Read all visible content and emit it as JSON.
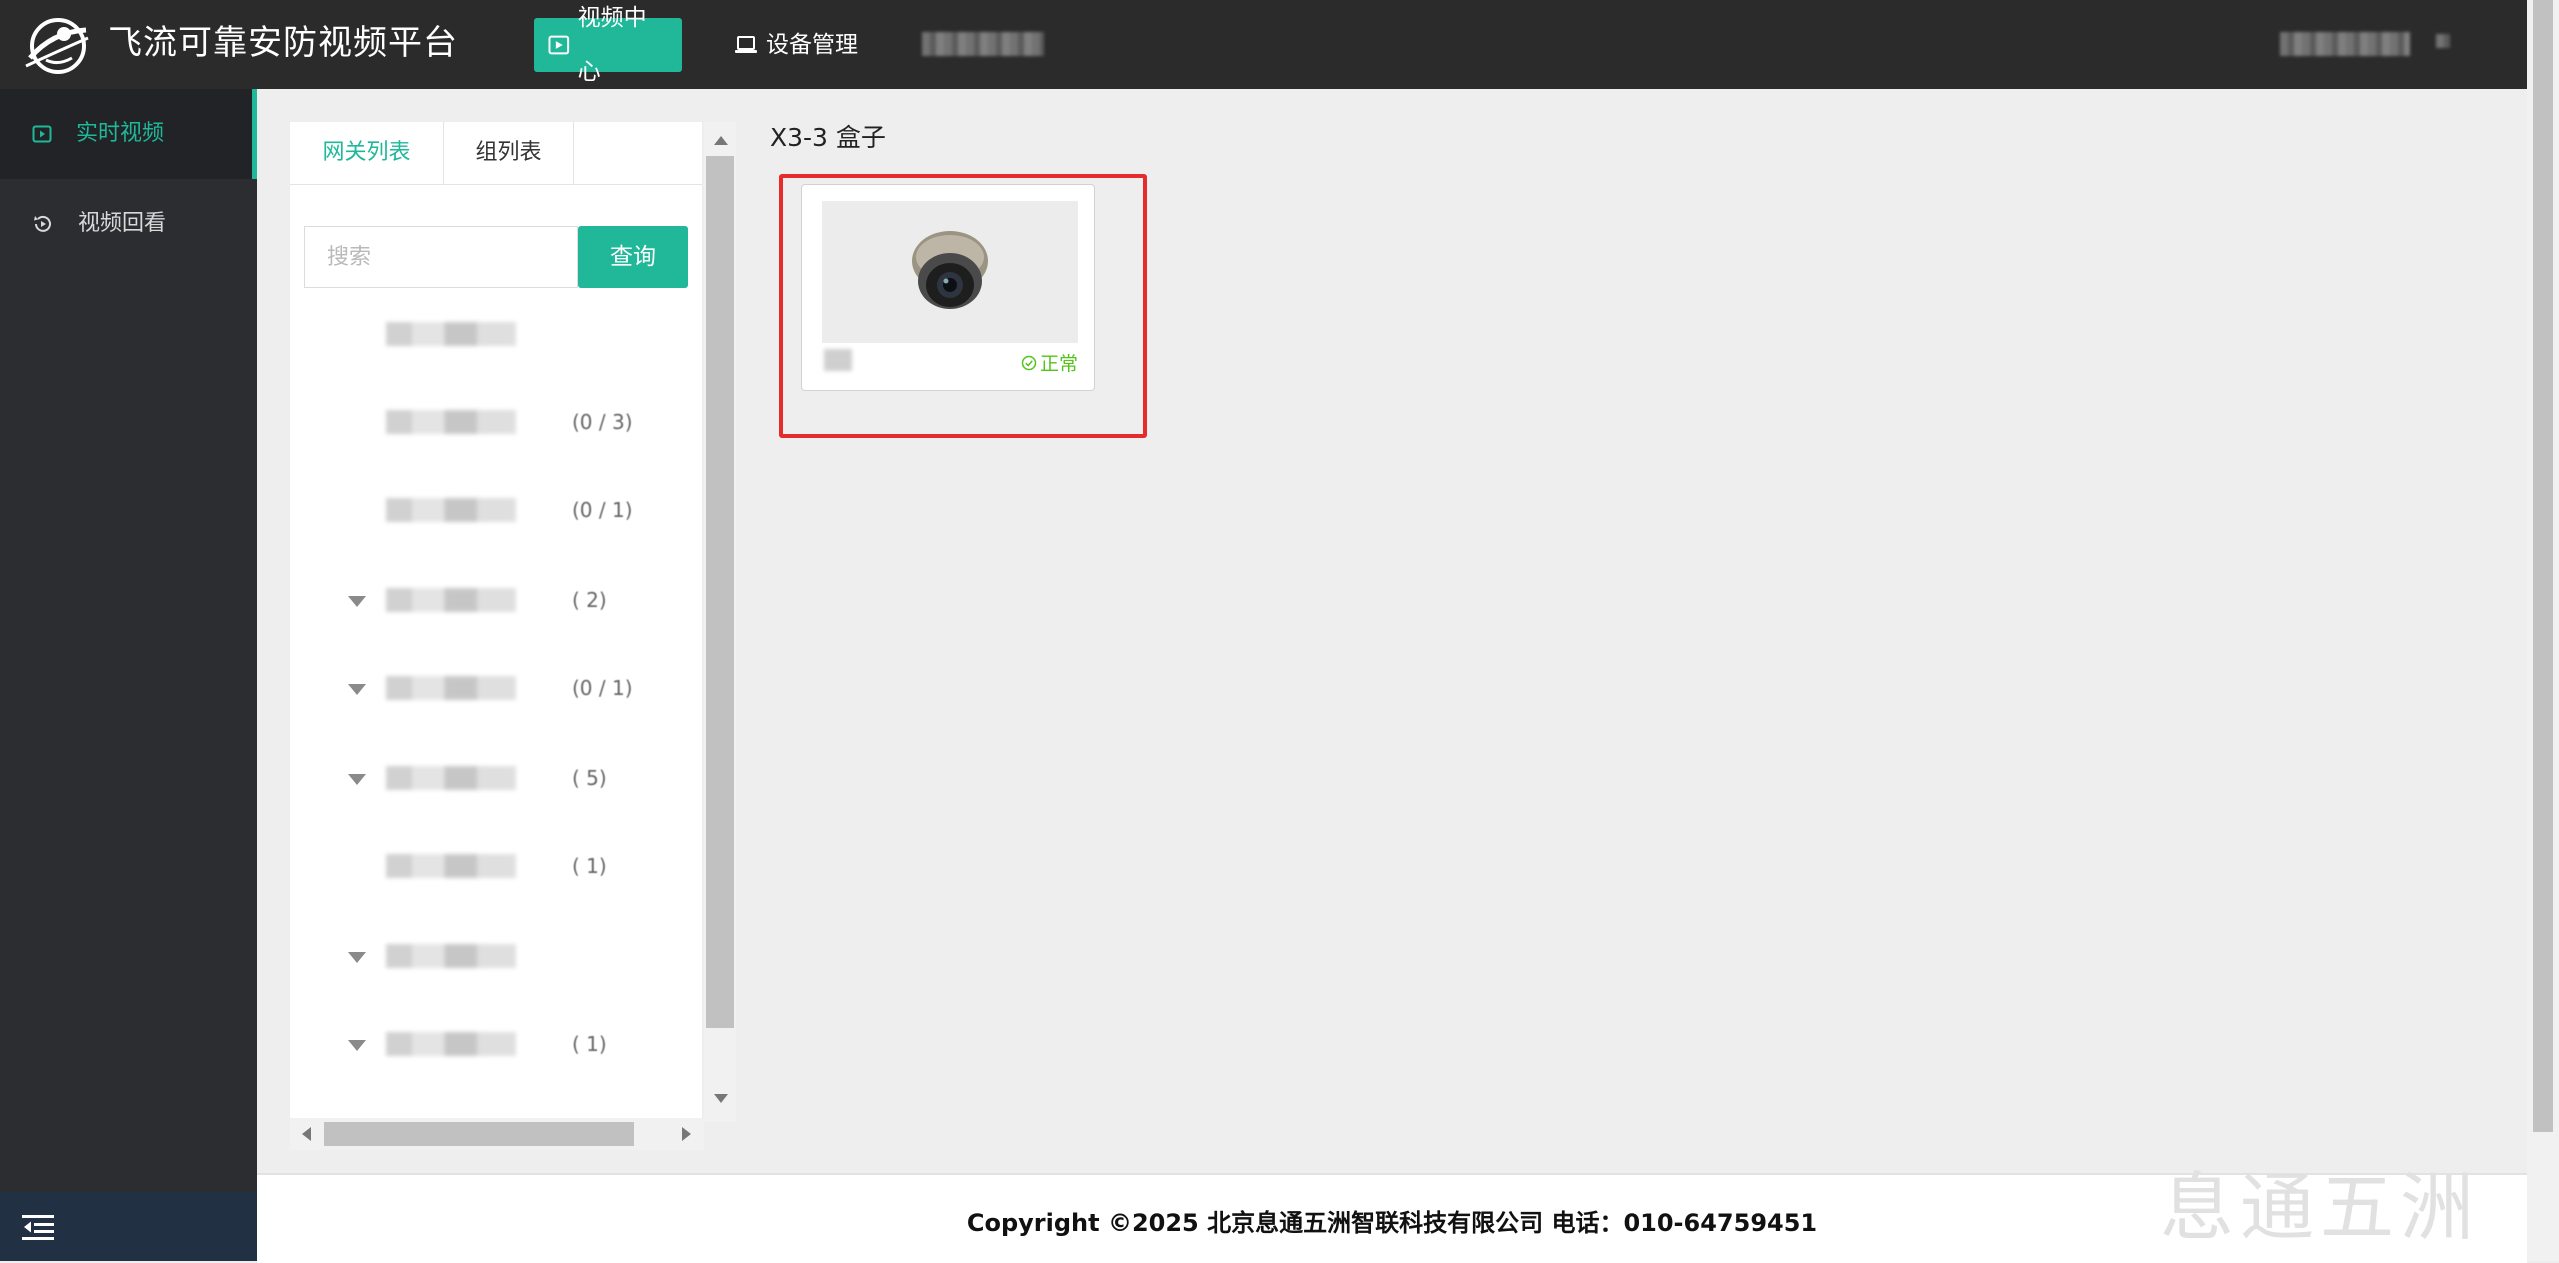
{
  "app": {
    "title": "飞流可靠安防视频平台"
  },
  "header": {
    "nav": [
      {
        "label": "视频中心",
        "active": true
      },
      {
        "label": "设备管理",
        "active": false
      }
    ]
  },
  "sidebar": {
    "items": [
      {
        "label": "实时视频",
        "active": true
      },
      {
        "label": "视频回看",
        "active": false
      }
    ]
  },
  "tree_panel": {
    "tabs": [
      {
        "label": "网关列表",
        "active": true
      },
      {
        "label": "组列表",
        "active": false
      }
    ],
    "search": {
      "placeholder": "搜索",
      "value": "",
      "button_label": "查询"
    },
    "rows": [
      {
        "count": "",
        "expandable": false
      },
      {
        "count": "(0 / 3)",
        "expandable": false
      },
      {
        "count": "(0 / 1)",
        "expandable": false
      },
      {
        "count": "(  2)",
        "expandable": true
      },
      {
        "count": "(0 / 1)",
        "expandable": true
      },
      {
        "count": "(  5)",
        "expandable": true
      },
      {
        "count": "(  1)",
        "expandable": false
      },
      {
        "count": "",
        "expandable": true
      },
      {
        "count": "(  1)",
        "expandable": true
      }
    ]
  },
  "main": {
    "section_title": "X3-3 盒子",
    "cameras": [
      {
        "status": "正常",
        "status_color": "#52c41a"
      }
    ]
  },
  "footer": {
    "copyright": "Copyright ©2025 北京息通五洲智联科技有限公司 电话：010-64759451",
    "watermark": "息通五洲"
  },
  "colors": {
    "accent": "#21b89a",
    "topbar": "#2b2b2b",
    "sidebar": "#2c2d30",
    "highlight": "#e52b2b"
  }
}
